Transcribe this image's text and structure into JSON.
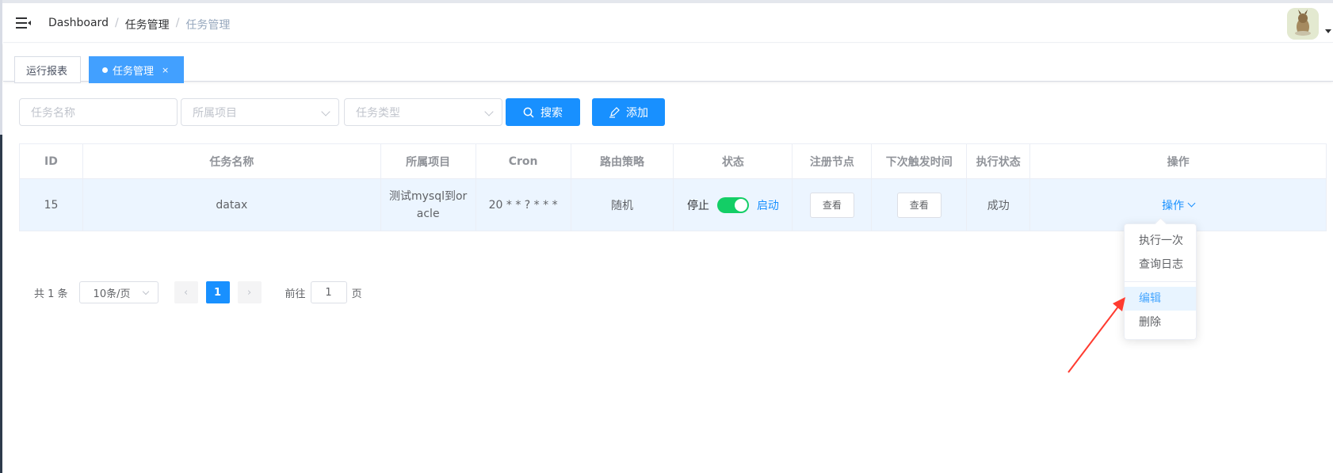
{
  "breadcrumb": [
    "Dashboard",
    "任务管理",
    "任务管理"
  ],
  "breadcrumb_separator": "/",
  "tags": {
    "tab1": "运行报表",
    "tab2": "任务管理",
    "close": "×"
  },
  "filters": {
    "name_placeholder": "任务名称",
    "project_placeholder": "所属项目",
    "type_placeholder": "任务类型",
    "search_label": "搜索",
    "add_label": "添加"
  },
  "table": {
    "headers": [
      "ID",
      "任务名称",
      "所属项目",
      "Cron",
      "路由策略",
      "状态",
      "注册节点",
      "下次触发时间",
      "执行状态",
      "操作"
    ],
    "rows": [
      {
        "id": "15",
        "name": "datax",
        "project": "测试mysql到oracle",
        "cron": "20 * * ? * * *",
        "route": "随机",
        "status_off": "停止",
        "status_on": "启动",
        "switch_on": true,
        "registry_btn": "查看",
        "next_btn": "查看",
        "exec_status": "成功",
        "op": "操作"
      }
    ]
  },
  "dropdown": {
    "items": [
      "执行一次",
      "查询日志",
      "编辑",
      "删除"
    ],
    "active_index": 2
  },
  "pagination": {
    "total": "共 1 条",
    "page_size": "10条/页",
    "current": "1",
    "jump_prefix": "前往",
    "jump_value": "1",
    "jump_suffix": "页"
  },
  "colors": {
    "primary": "#1890ff",
    "switch_on": "#13ce66",
    "annotation_arrow": "#ff3b30"
  },
  "icons": [
    "hamburger-icon",
    "search-icon",
    "edit-icon",
    "chevron-down-icon",
    "chevron-left-icon",
    "chevron-right-icon",
    "close-icon"
  ]
}
